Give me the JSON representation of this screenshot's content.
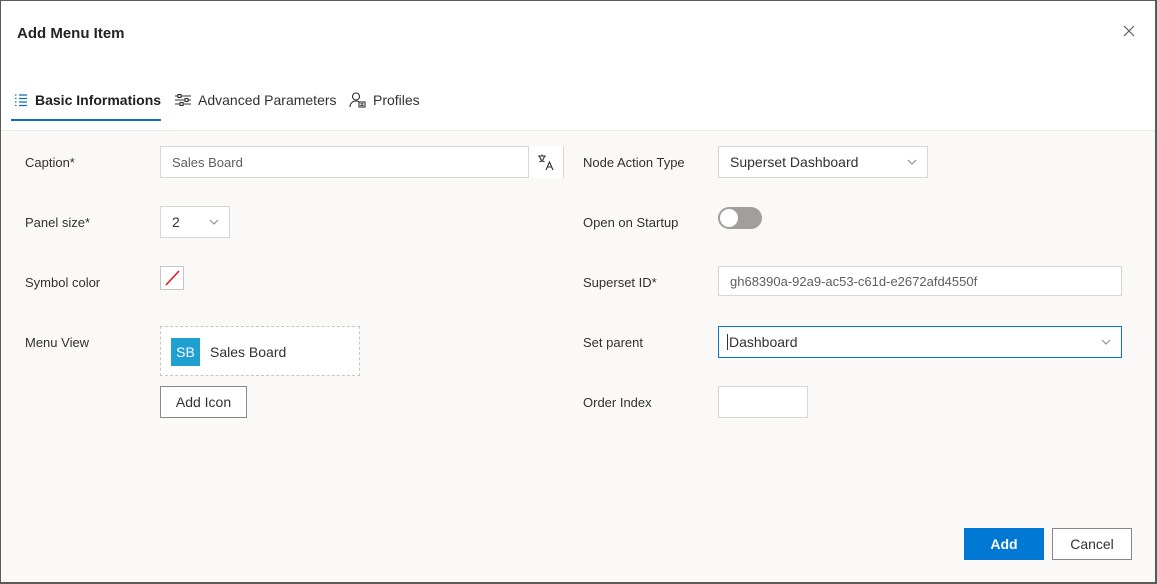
{
  "dialog": {
    "title": "Add Menu Item"
  },
  "tabs": [
    {
      "label": "Basic Informations",
      "icon": "list-icon",
      "active": true
    },
    {
      "label": "Advanced Parameters",
      "icon": "sliders-icon",
      "active": false
    },
    {
      "label": "Profiles",
      "icon": "profile-icon",
      "active": false
    }
  ],
  "form": {
    "caption": {
      "label": "Caption*",
      "value": "Sales Board"
    },
    "panel_size": {
      "label": "Panel size*",
      "value": "2"
    },
    "symbol_color": {
      "label": "Symbol color"
    },
    "menu_view": {
      "label": "Menu View",
      "avatar_text": "SB",
      "avatar_color": "#1fa0d3",
      "name": "Sales Board"
    },
    "add_icon_label": "Add Icon",
    "node_action_type": {
      "label": "Node Action Type",
      "value": "Superset Dashboard"
    },
    "open_on_startup": {
      "label": "Open on Startup",
      "on": false
    },
    "superset_id": {
      "label": "Superset ID*",
      "value": "gh68390a-92a9-ac53-c61d-e2672afd4550f"
    },
    "set_parent": {
      "label": "Set parent",
      "value": "Dashboard"
    },
    "order_index": {
      "label": "Order Index",
      "value": ""
    }
  },
  "footer": {
    "add_label": "Add",
    "cancel_label": "Cancel"
  },
  "colors": {
    "primary": "#0078d4",
    "tab_accent": "#0f6cbd"
  }
}
